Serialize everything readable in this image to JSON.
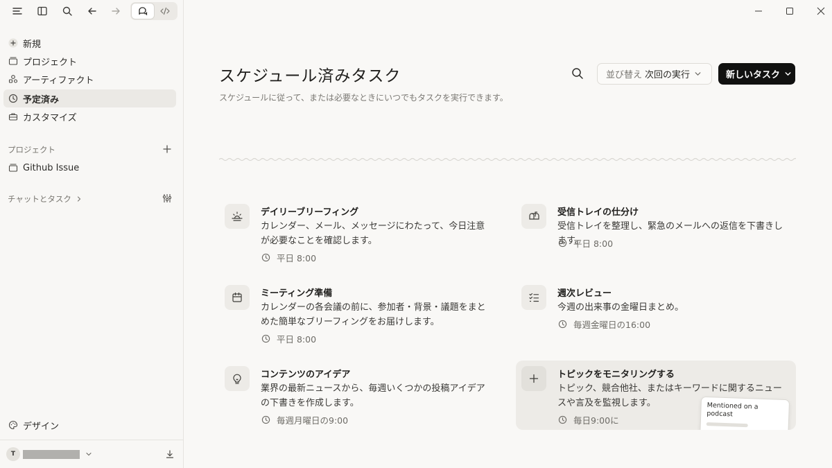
{
  "window": {
    "controls": [
      "minimize",
      "maximize",
      "close"
    ]
  },
  "toolbar": {
    "icons": [
      "menu-icon",
      "sidebar-toggle-icon",
      "search-icon",
      "back-icon",
      "forward-icon"
    ],
    "modes": [
      "chat-mode",
      "code-mode"
    ]
  },
  "sidebar": {
    "nav": [
      {
        "label": "新規",
        "icon": "plus-icon"
      },
      {
        "label": "プロジェクト",
        "icon": "folder-icon"
      },
      {
        "label": "アーティファクト",
        "icon": "artifact-icon"
      },
      {
        "label": "予定済み",
        "icon": "clock-icon",
        "active": true
      },
      {
        "label": "カスタマイズ",
        "icon": "briefcase-icon"
      }
    ],
    "projects_title": "プロジェクト",
    "projects": [
      {
        "label": "Github Issue",
        "icon": "folder-icon"
      }
    ],
    "chats_title": "チャットとタスク",
    "design_label": "デザイン",
    "user_initial": "T"
  },
  "main": {
    "title": "スケジュール済みタスク",
    "subtitle": "スケジュールに従って、または必要なときにいつでもタスクを実行できます。",
    "sort": {
      "prefix": "並び替え",
      "value": "次回の実行"
    },
    "new_task_label": "新しいタスク",
    "cards": [
      {
        "title": "デイリーブリーフィング",
        "desc": "カレンダー、メール、メッセージにわたって、今日注意が必要なことを確認します。",
        "schedule": "平日 8:00",
        "icon": "sunrise-icon"
      },
      {
        "title": "受信トレイの仕分け",
        "desc": "受信トレイを整理し、緊急のメールへの返信を下書きします。",
        "schedule": "平日 8:00",
        "icon": "mailbox-icon"
      },
      {
        "title": "ミーティング準備",
        "desc": "カレンダーの各会議の前に、参加者・背景・議題をまとめた簡単なブリーフィングをお届けします。",
        "schedule": "平日 8:00",
        "icon": "calendar-icon"
      },
      {
        "title": "週次レビュー",
        "desc": "今週の出来事の金曜日まとめ。",
        "schedule": "毎週金曜日の16:00",
        "icon": "checklist-icon"
      },
      {
        "title": "コンテンツのアイデア",
        "desc": "業界の最新ニュースから、毎週いくつかの投稿アイデアの下書きを作成します。",
        "schedule": "毎週月曜日の9:00",
        "icon": "lightbulb-icon"
      },
      {
        "title": "トピックをモニタリングする",
        "desc": "トピック、競合他社、またはキーワードに関するニュースや言及を監視します。",
        "schedule": "毎日9:00に",
        "icon": "plus-icon",
        "preview": "Mentioned on a podcast"
      }
    ]
  }
}
